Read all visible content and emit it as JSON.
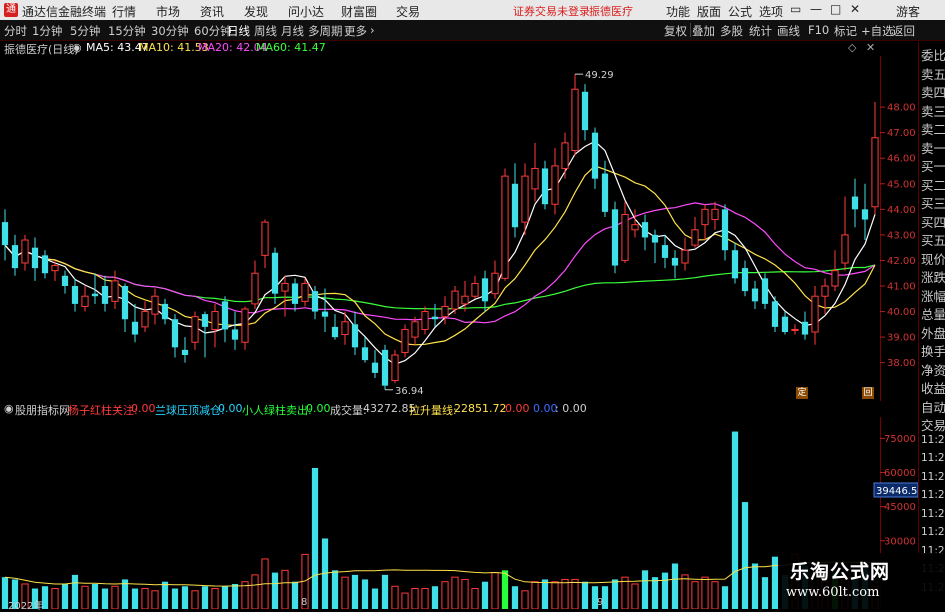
{
  "titlebar": {
    "app_title": "通达信金融终端",
    "menu": [
      "行情",
      "市场",
      "资讯",
      "发现",
      "问小达",
      "财富圈",
      "交易"
    ],
    "warning": "证券交易未登录",
    "stock_name_red": "振德医疗",
    "right_menu": [
      "功能",
      "版面",
      "公式",
      "选项"
    ],
    "guest": "游客"
  },
  "toolbar": {
    "periods": [
      "分时",
      "1分钟",
      "5分钟",
      "15分钟",
      "30分钟",
      "60分钟",
      "日线",
      "周线",
      "月线",
      "多周期",
      "更多"
    ],
    "active_period": "日线",
    "right_buttons": [
      "复权",
      "叠加",
      "多股",
      "统计",
      "画线",
      "F10",
      "标记",
      "+自选",
      "返回"
    ]
  },
  "info": {
    "stock": "振德医疗(日线)",
    "ma5": "MA5: 43.47",
    "ma10": "MA10: 41.53",
    "ma20": "MA20: 42.04",
    "ma60": "MA60: 41.47",
    "high_label": "49.29",
    "low_label": "36.94"
  },
  "indicator": {
    "name": "股朋指标网",
    "items": [
      {
        "label": "杨子红柱关注:",
        "value": "0.00",
        "color": "#ff3a3a"
      },
      {
        "label": "兰球压顶减仓:",
        "value": "0.00",
        "color": "#27d3ff"
      },
      {
        "label": "小人绿柱卖出:",
        "value": "0.00",
        "color": "#27ff3a"
      },
      {
        "label": "成交量:",
        "value": "43272.85",
        "color": "#cfcfcf"
      },
      {
        "label": "拉升量线:",
        "value": "22851.72",
        "color": "#ffe24a"
      },
      {
        "label": "",
        "value": "0.00",
        "color": "#ff3a3a"
      },
      {
        "label": "",
        "value": "0.00",
        "color": "#3a6bff"
      },
      {
        "label": "",
        "value": ": 0.00",
        "color": "#cfcfcf"
      }
    ]
  },
  "price_axis": {
    "labels": [
      "48.00",
      "47.00",
      "46.00",
      "45.00",
      "44.00",
      "43.00",
      "42.00",
      "41.00",
      "40.00",
      "39.00",
      "38.00"
    ]
  },
  "volume_axis": {
    "labels": [
      "75000",
      "60000",
      "45000",
      "30000"
    ],
    "current": "39446.59"
  },
  "dates": {
    "d1": "2022年",
    "d2": "8",
    "d3": "9"
  },
  "markers": {
    "ding": "定",
    "hui": "回"
  },
  "sidebar": {
    "items": [
      "委比",
      "卖五",
      "卖四",
      "卖三",
      "卖二",
      "卖一",
      "买一",
      "买二",
      "买三",
      "买四",
      "买五",
      "现价",
      "涨跌",
      "涨幅",
      "总量",
      "外盘",
      "换手",
      "净资",
      "收益",
      "自动",
      "交易",
      "11:29",
      "11:29",
      "11:29",
      "11:29",
      "11:29",
      "11:29",
      "11:29",
      "11:29",
      "11:29"
    ]
  },
  "watermark": {
    "line1": "乐淘公式网",
    "line2": "www.60lt.com"
  },
  "chart_data": {
    "type": "candlestick",
    "price_range": [
      36.5,
      50.0
    ],
    "candles": [
      [
        43.5,
        42.6,
        44.0,
        42.0
      ],
      [
        42.6,
        41.7,
        43.0,
        41.4
      ],
      [
        41.9,
        42.8,
        43.0,
        41.6
      ],
      [
        42.5,
        41.7,
        42.9,
        41.2
      ],
      [
        42.2,
        41.5,
        42.4,
        41.3
      ],
      [
        41.6,
        41.8,
        42.0,
        41.2
      ],
      [
        41.4,
        41.0,
        41.6,
        40.7
      ],
      [
        41.0,
        40.3,
        41.3,
        40.0
      ],
      [
        40.2,
        40.6,
        41.0,
        40.0
      ],
      [
        40.7,
        40.6,
        41.5,
        40.3
      ],
      [
        41.0,
        40.3,
        41.4,
        40.0
      ],
      [
        40.4,
        41.2,
        41.6,
        40.1
      ],
      [
        41.0,
        39.7,
        41.1,
        39.2
      ],
      [
        39.6,
        39.1,
        40.3,
        38.8
      ],
      [
        39.4,
        40.0,
        40.4,
        39.2
      ],
      [
        39.9,
        40.6,
        40.9,
        39.5
      ],
      [
        40.3,
        39.7,
        40.5,
        39.5
      ],
      [
        39.7,
        38.6,
        39.9,
        38.2
      ],
      [
        38.5,
        38.3,
        39.0,
        38.0
      ],
      [
        38.8,
        39.8,
        40.0,
        38.5
      ],
      [
        39.9,
        39.4,
        40.0,
        38.2
      ],
      [
        39.3,
        40.0,
        40.3,
        38.6
      ],
      [
        40.4,
        39.3,
        40.6,
        38.8
      ],
      [
        39.3,
        38.9,
        40.0,
        38.5
      ],
      [
        38.8,
        40.1,
        40.2,
        38.5
      ],
      [
        40.3,
        41.5,
        42.0,
        40.1
      ],
      [
        42.2,
        43.5,
        43.6,
        41.7
      ],
      [
        42.3,
        40.7,
        42.5,
        40.3
      ],
      [
        40.8,
        41.1,
        41.4,
        39.8
      ],
      [
        41.1,
        40.3,
        41.3,
        40.0
      ],
      [
        40.4,
        41.1,
        41.3,
        40.2
      ],
      [
        40.8,
        40.0,
        41.0,
        39.7
      ],
      [
        40.0,
        39.8,
        40.9,
        39.2
      ],
      [
        39.4,
        39.0,
        39.9,
        38.9
      ],
      [
        39.1,
        39.6,
        40.0,
        38.7
      ],
      [
        39.5,
        38.6,
        40.0,
        38.3
      ],
      [
        38.6,
        38.1,
        39.0,
        38.0
      ],
      [
        38.0,
        37.6,
        38.5,
        37.4
      ],
      [
        38.5,
        37.1,
        38.7,
        36.94
      ],
      [
        37.3,
        38.3,
        38.5,
        37.2
      ],
      [
        38.4,
        39.3,
        39.5,
        38.2
      ],
      [
        39.0,
        39.6,
        39.8,
        38.7
      ],
      [
        39.3,
        40.0,
        40.2,
        39.1
      ],
      [
        39.8,
        39.7,
        40.3,
        39.4
      ],
      [
        39.8,
        40.2,
        40.6,
        39.5
      ],
      [
        40.1,
        40.8,
        41.0,
        39.9
      ],
      [
        40.3,
        40.6,
        41.2,
        40.0
      ],
      [
        40.6,
        41.1,
        41.4,
        40.5
      ],
      [
        41.3,
        40.4,
        41.6,
        40.0
      ],
      [
        40.7,
        41.5,
        42.0,
        40.5
      ],
      [
        41.3,
        45.3,
        45.6,
        41.2
      ],
      [
        45.0,
        43.3,
        45.8,
        42.9
      ],
      [
        43.5,
        45.3,
        45.8,
        43.0
      ],
      [
        44.8,
        45.6,
        46.6,
        44.3
      ],
      [
        45.6,
        44.2,
        45.9,
        44.0
      ],
      [
        44.2,
        45.7,
        46.4,
        43.8
      ],
      [
        45.6,
        46.6,
        47.0,
        45.2
      ],
      [
        46.3,
        48.7,
        49.29,
        46.1
      ],
      [
        48.6,
        47.1,
        48.9,
        46.7
      ],
      [
        47.0,
        45.2,
        47.2,
        44.8
      ],
      [
        45.4,
        43.9,
        45.9,
        43.7
      ],
      [
        44.0,
        41.8,
        44.3,
        41.5
      ],
      [
        42.0,
        43.8,
        44.3,
        41.9
      ],
      [
        43.2,
        43.4,
        44.0,
        42.9
      ],
      [
        43.5,
        42.9,
        43.8,
        42.4
      ],
      [
        43.0,
        42.7,
        43.2,
        41.9
      ],
      [
        42.6,
        42.1,
        43.0,
        41.7
      ],
      [
        42.1,
        41.8,
        42.4,
        41.3
      ],
      [
        41.9,
        42.4,
        42.9,
        41.6
      ],
      [
        42.6,
        43.2,
        43.7,
        42.5
      ],
      [
        43.4,
        44.0,
        44.2,
        42.8
      ],
      [
        43.6,
        44.0,
        44.3,
        43.2
      ],
      [
        44.0,
        42.4,
        44.2,
        42.0
      ],
      [
        42.4,
        41.3,
        42.7,
        41.1
      ],
      [
        41.7,
        40.8,
        42.0,
        40.6
      ],
      [
        40.9,
        40.4,
        41.2,
        40.1
      ],
      [
        41.3,
        40.3,
        41.5,
        40.1
      ],
      [
        40.4,
        39.4,
        40.6,
        39.2
      ],
      [
        39.8,
        39.2,
        40.0,
        39.1
      ],
      [
        39.3,
        39.3,
        39.5,
        39.1
      ],
      [
        39.6,
        39.1,
        40.0,
        38.9
      ],
      [
        39.2,
        40.6,
        41.0,
        38.7
      ],
      [
        40.6,
        41.0,
        41.3,
        39.9
      ],
      [
        41.0,
        41.6,
        42.4,
        40.8
      ],
      [
        41.9,
        43.0,
        44.5,
        41.6
      ],
      [
        44.5,
        44.0,
        45.2,
        43.3
      ],
      [
        44.0,
        43.6,
        45.0,
        42.8
      ],
      [
        44.1,
        46.8,
        48.2,
        43.8
      ]
    ],
    "volumes": [
      14,
      13,
      11,
      9,
      10,
      9,
      11,
      15,
      10,
      11,
      9,
      10,
      13,
      9,
      9,
      8,
      12,
      9,
      10,
      8,
      10,
      9,
      10,
      11,
      12,
      15,
      22,
      16,
      17,
      12,
      24,
      62,
      31,
      17,
      14,
      15,
      13,
      9,
      15,
      10,
      7,
      9,
      9,
      10,
      12,
      14,
      13,
      9,
      12,
      16,
      17,
      10,
      8,
      12,
      13,
      12,
      13,
      13,
      12,
      10,
      10,
      13,
      14,
      11,
      17,
      14,
      16,
      20,
      15,
      12,
      14,
      12,
      10,
      78,
      47,
      20,
      14,
      23,
      15,
      24,
      19,
      16,
      12,
      16,
      14,
      13,
      18,
      10,
      11,
      14,
      11,
      9,
      11,
      10,
      12,
      11,
      10,
      11,
      9,
      9,
      10,
      9,
      8,
      11,
      11,
      14,
      20,
      18,
      16,
      14,
      11,
      14,
      7,
      8,
      3,
      1
    ],
    "volume_range": [
      0,
      80000
    ]
  }
}
